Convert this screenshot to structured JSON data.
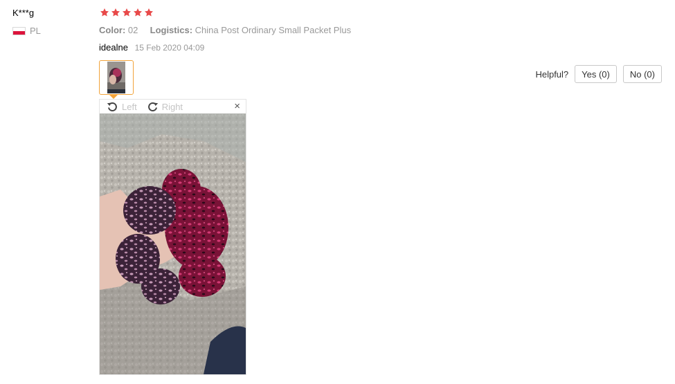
{
  "reviewer": {
    "name": "K***g",
    "country": "PL"
  },
  "rating": {
    "stars": 5,
    "max": 5,
    "color": "#e84a4a"
  },
  "attributes": [
    {
      "key": "Color:",
      "value": "02"
    },
    {
      "key": "Logistics:",
      "value": "China Post Ordinary Small Packet Plus"
    }
  ],
  "comment": {
    "text": "idealne",
    "date": "15 Feb 2020 04:09"
  },
  "helpful": {
    "label": "Helpful?",
    "yes": "Yes (0)",
    "no": "No (0)"
  },
  "viewer": {
    "rotate_left": "Left",
    "rotate_right": "Right",
    "close": "×"
  },
  "colors": {
    "accent": "#f2a33a",
    "star": "#e84a4a"
  }
}
